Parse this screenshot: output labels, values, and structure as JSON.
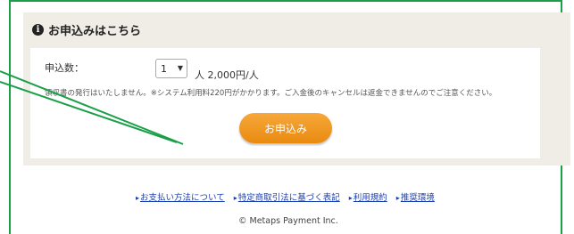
{
  "section": {
    "title": "お申込みはこちら",
    "info_icon": "i"
  },
  "form": {
    "quantity_label": "申込数：",
    "quantity_value": "1",
    "per_price": "人 2,000円/人",
    "notice": "領収書の発行はいたしません。※システム利用料220円がかかります。ご入金後のキャンセルは返金できませんのでご注意ください。",
    "apply_button": "お申込み"
  },
  "footer": {
    "links": [
      "お支払い方法について",
      "特定商取引法に基づく表記",
      "利用規約",
      "推奨環境"
    ],
    "copyright": "© Metaps Payment Inc."
  },
  "colors": {
    "annotation": "#1a9f48",
    "button": "#f29a22",
    "panel_bg": "#efede6"
  }
}
